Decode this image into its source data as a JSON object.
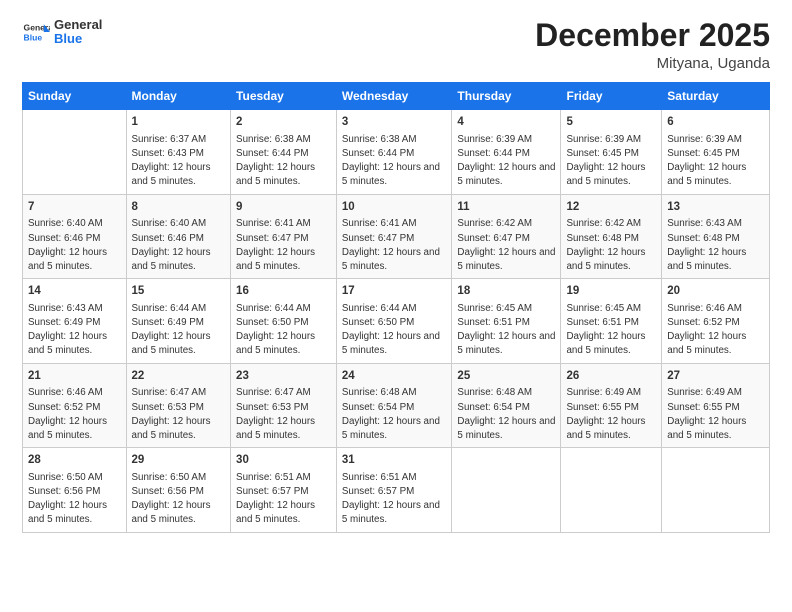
{
  "logo": {
    "text_general": "General",
    "text_blue": "Blue"
  },
  "header": {
    "title": "December 2025",
    "subtitle": "Mityana, Uganda"
  },
  "days_of_week": [
    "Sunday",
    "Monday",
    "Tuesday",
    "Wednesday",
    "Thursday",
    "Friday",
    "Saturday"
  ],
  "weeks": [
    [
      {
        "day": "",
        "sunrise": "",
        "sunset": "",
        "daylight": ""
      },
      {
        "day": "1",
        "sunrise": "6:37 AM",
        "sunset": "6:43 PM",
        "daylight": "12 hours and 5 minutes."
      },
      {
        "day": "2",
        "sunrise": "6:38 AM",
        "sunset": "6:44 PM",
        "daylight": "12 hours and 5 minutes."
      },
      {
        "day": "3",
        "sunrise": "6:38 AM",
        "sunset": "6:44 PM",
        "daylight": "12 hours and 5 minutes."
      },
      {
        "day": "4",
        "sunrise": "6:39 AM",
        "sunset": "6:44 PM",
        "daylight": "12 hours and 5 minutes."
      },
      {
        "day": "5",
        "sunrise": "6:39 AM",
        "sunset": "6:45 PM",
        "daylight": "12 hours and 5 minutes."
      },
      {
        "day": "6",
        "sunrise": "6:39 AM",
        "sunset": "6:45 PM",
        "daylight": "12 hours and 5 minutes."
      }
    ],
    [
      {
        "day": "7",
        "sunrise": "6:40 AM",
        "sunset": "6:46 PM",
        "daylight": "12 hours and 5 minutes."
      },
      {
        "day": "8",
        "sunrise": "6:40 AM",
        "sunset": "6:46 PM",
        "daylight": "12 hours and 5 minutes."
      },
      {
        "day": "9",
        "sunrise": "6:41 AM",
        "sunset": "6:47 PM",
        "daylight": "12 hours and 5 minutes."
      },
      {
        "day": "10",
        "sunrise": "6:41 AM",
        "sunset": "6:47 PM",
        "daylight": "12 hours and 5 minutes."
      },
      {
        "day": "11",
        "sunrise": "6:42 AM",
        "sunset": "6:47 PM",
        "daylight": "12 hours and 5 minutes."
      },
      {
        "day": "12",
        "sunrise": "6:42 AM",
        "sunset": "6:48 PM",
        "daylight": "12 hours and 5 minutes."
      },
      {
        "day": "13",
        "sunrise": "6:43 AM",
        "sunset": "6:48 PM",
        "daylight": "12 hours and 5 minutes."
      }
    ],
    [
      {
        "day": "14",
        "sunrise": "6:43 AM",
        "sunset": "6:49 PM",
        "daylight": "12 hours and 5 minutes."
      },
      {
        "day": "15",
        "sunrise": "6:44 AM",
        "sunset": "6:49 PM",
        "daylight": "12 hours and 5 minutes."
      },
      {
        "day": "16",
        "sunrise": "6:44 AM",
        "sunset": "6:50 PM",
        "daylight": "12 hours and 5 minutes."
      },
      {
        "day": "17",
        "sunrise": "6:44 AM",
        "sunset": "6:50 PM",
        "daylight": "12 hours and 5 minutes."
      },
      {
        "day": "18",
        "sunrise": "6:45 AM",
        "sunset": "6:51 PM",
        "daylight": "12 hours and 5 minutes."
      },
      {
        "day": "19",
        "sunrise": "6:45 AM",
        "sunset": "6:51 PM",
        "daylight": "12 hours and 5 minutes."
      },
      {
        "day": "20",
        "sunrise": "6:46 AM",
        "sunset": "6:52 PM",
        "daylight": "12 hours and 5 minutes."
      }
    ],
    [
      {
        "day": "21",
        "sunrise": "6:46 AM",
        "sunset": "6:52 PM",
        "daylight": "12 hours and 5 minutes."
      },
      {
        "day": "22",
        "sunrise": "6:47 AM",
        "sunset": "6:53 PM",
        "daylight": "12 hours and 5 minutes."
      },
      {
        "day": "23",
        "sunrise": "6:47 AM",
        "sunset": "6:53 PM",
        "daylight": "12 hours and 5 minutes."
      },
      {
        "day": "24",
        "sunrise": "6:48 AM",
        "sunset": "6:54 PM",
        "daylight": "12 hours and 5 minutes."
      },
      {
        "day": "25",
        "sunrise": "6:48 AM",
        "sunset": "6:54 PM",
        "daylight": "12 hours and 5 minutes."
      },
      {
        "day": "26",
        "sunrise": "6:49 AM",
        "sunset": "6:55 PM",
        "daylight": "12 hours and 5 minutes."
      },
      {
        "day": "27",
        "sunrise": "6:49 AM",
        "sunset": "6:55 PM",
        "daylight": "12 hours and 5 minutes."
      }
    ],
    [
      {
        "day": "28",
        "sunrise": "6:50 AM",
        "sunset": "6:56 PM",
        "daylight": "12 hours and 5 minutes."
      },
      {
        "day": "29",
        "sunrise": "6:50 AM",
        "sunset": "6:56 PM",
        "daylight": "12 hours and 5 minutes."
      },
      {
        "day": "30",
        "sunrise": "6:51 AM",
        "sunset": "6:57 PM",
        "daylight": "12 hours and 5 minutes."
      },
      {
        "day": "31",
        "sunrise": "6:51 AM",
        "sunset": "6:57 PM",
        "daylight": "12 hours and 5 minutes."
      },
      {
        "day": "",
        "sunrise": "",
        "sunset": "",
        "daylight": ""
      },
      {
        "day": "",
        "sunrise": "",
        "sunset": "",
        "daylight": ""
      },
      {
        "day": "",
        "sunrise": "",
        "sunset": "",
        "daylight": ""
      }
    ]
  ]
}
